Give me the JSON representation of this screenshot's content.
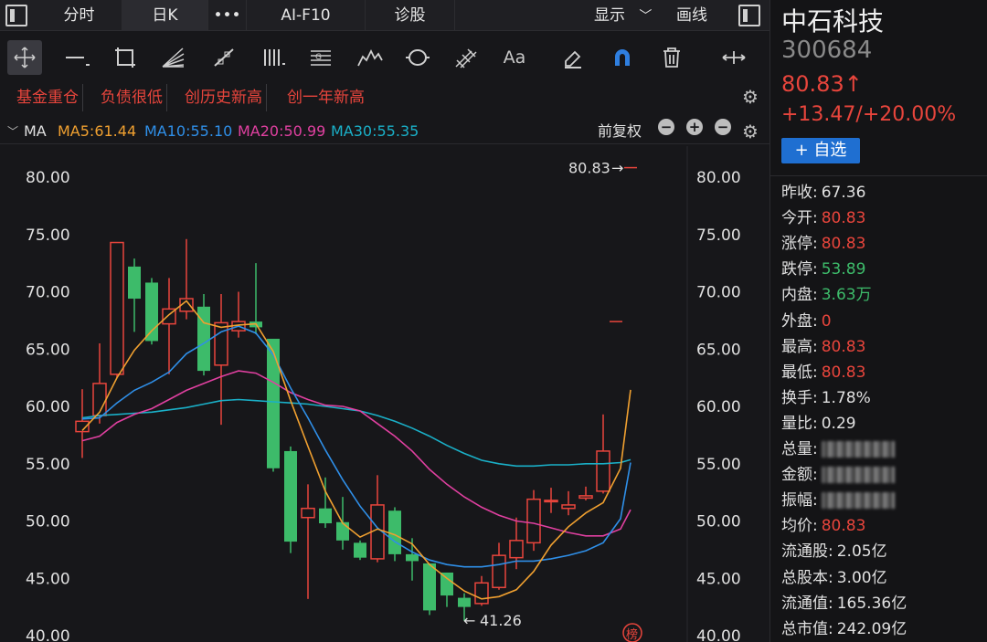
{
  "tabs": [
    "分时",
    "日K",
    "•••",
    "AI-F10",
    "诊股"
  ],
  "active_tab": 1,
  "top_right": {
    "display_label": "显示",
    "draw_label": "画线"
  },
  "tools": [
    "crosshair-icon",
    "line-icon",
    "rect-icon",
    "fan-icon",
    "ray-icon",
    "vlines-icon",
    "channel-icon",
    "wave-icon",
    "cycle-icon",
    "pitchfork-icon",
    "text-icon",
    "eraser-icon",
    "magnet-icon",
    "trash-icon",
    "arrows-icon"
  ],
  "tool_text_label": "Aa",
  "tags": [
    "基金重仓",
    "负债很低",
    "创历史新高",
    "创一年新高"
  ],
  "ma": {
    "label": "MA",
    "ma5": "MA5:61.44",
    "ma10": "MA10:55.10",
    "ma20": "MA20:50.99",
    "ma30": "MA30:55.35",
    "adjust": "前复权",
    "colors": {
      "ma5": "#f0a030",
      "ma10": "#2f8fe8",
      "ma20": "#e040a0",
      "ma30": "#1ab0c8"
    }
  },
  "chart_data": {
    "type": "candlestick",
    "ylim": [
      40,
      81.5
    ],
    "yticks": [
      40,
      45,
      50,
      55,
      60,
      65,
      70,
      75,
      80
    ],
    "ytick_labels": [
      "40.00",
      "45.00",
      "50.00",
      "55.00",
      "60.00",
      "65.00",
      "70.00",
      "75.00",
      "80.00"
    ],
    "candles": [
      {
        "o": 57.8,
        "c": 58.7,
        "h": 61.5,
        "l": 55.5
      },
      {
        "o": 59.2,
        "c": 62.0,
        "h": 65.5,
        "l": 58.5
      },
      {
        "o": 62.8,
        "c": 74.3,
        "h": 74.3,
        "l": 62.5
      },
      {
        "o": 72.2,
        "c": 69.4,
        "h": 72.9,
        "l": 66.5
      },
      {
        "o": 70.8,
        "c": 65.7,
        "h": 71.2,
        "l": 65.4
      },
      {
        "o": 67.2,
        "c": 68.5,
        "h": 71.2,
        "l": 62.8
      },
      {
        "o": 68.3,
        "c": 69.4,
        "h": 74.6,
        "l": 67.6
      },
      {
        "o": 68.7,
        "c": 63.1,
        "h": 69.8,
        "l": 62.7
      },
      {
        "o": 63.6,
        "c": 67.3,
        "h": 69.8,
        "l": 58.4
      },
      {
        "o": 66.6,
        "c": 67.4,
        "h": 70.0,
        "l": 66.0
      },
      {
        "o": 67.4,
        "c": 66.9,
        "h": 72.5,
        "l": 66.3
      },
      {
        "o": 65.9,
        "c": 54.6,
        "h": 65.9,
        "l": 54.3
      },
      {
        "o": 56.1,
        "c": 48.2,
        "h": 56.5,
        "l": 47.2
      },
      {
        "o": 50.3,
        "c": 51.1,
        "h": 53.2,
        "l": 43.2
      },
      {
        "o": 51.1,
        "c": 49.8,
        "h": 53.8,
        "l": 49.4
      },
      {
        "o": 49.9,
        "c": 48.3,
        "h": 52.1,
        "l": 47.5
      },
      {
        "o": 48.1,
        "c": 46.8,
        "h": 48.3,
        "l": 46.6
      },
      {
        "o": 46.7,
        "c": 51.4,
        "h": 54.0,
        "l": 46.4
      },
      {
        "o": 50.9,
        "c": 47.1,
        "h": 51.2,
        "l": 46.5
      },
      {
        "o": 47.1,
        "c": 46.5,
        "h": 48.5,
        "l": 44.8
      },
      {
        "o": 46.3,
        "c": 42.2,
        "h": 46.3,
        "l": 41.8
      },
      {
        "o": 45.5,
        "c": 43.5,
        "h": 45.5,
        "l": 42.5
      },
      {
        "o": 43.3,
        "c": 42.5,
        "h": 43.7,
        "l": 41.3
      },
      {
        "o": 42.8,
        "c": 44.6,
        "h": 45.2,
        "l": 42.6
      },
      {
        "o": 44.2,
        "c": 47.0,
        "h": 48.1,
        "l": 44.0
      },
      {
        "o": 46.8,
        "c": 48.3,
        "h": 50.3,
        "l": 45.8
      },
      {
        "o": 48.1,
        "c": 51.9,
        "h": 52.7,
        "l": 47.4
      },
      {
        "o": 51.8,
        "c": 51.8,
        "h": 52.9,
        "l": 50.7
      },
      {
        "o": 51.1,
        "c": 51.4,
        "h": 52.6,
        "l": 50.5
      },
      {
        "o": 52.0,
        "c": 52.2,
        "h": 53.0,
        "l": 51.8
      },
      {
        "o": 52.6,
        "c": 56.1,
        "h": 59.3,
        "l": 52.4
      },
      {
        "o": 67.4,
        "c": 67.4,
        "h": 67.4,
        "l": 67.4
      },
      {
        "o": 80.83,
        "c": 80.83,
        "h": 80.83,
        "l": 80.83
      }
    ],
    "ma_lines": {
      "ma5": [
        57.9,
        59.5,
        62.5,
        64.9,
        66.6,
        68.0,
        69.2,
        67.3,
        66.9,
        67.1,
        67.2,
        64.8,
        60.5,
        56.5,
        52.6,
        49.8,
        48.6,
        49.3,
        48.8,
        48.0,
        46.2,
        45.0,
        43.9,
        43.2,
        43.4,
        44.0,
        45.6,
        47.9,
        49.5,
        50.7,
        51.6,
        54.6,
        61.44
      ],
      "ma10": [
        58.9,
        59.0,
        60.3,
        61.4,
        62.1,
        63.0,
        64.6,
        65.5,
        66.5,
        67.0,
        66.4,
        64.5,
        61.6,
        59.0,
        56.2,
        53.6,
        51.3,
        49.4,
        48.2,
        47.3,
        46.6,
        46.2,
        46.0,
        46.0,
        46.2,
        46.5,
        46.5,
        46.7,
        47.0,
        47.4,
        48.1,
        50.2,
        55.1
      ],
      "ma20": [
        57.0,
        57.4,
        58.6,
        59.3,
        59.8,
        60.6,
        61.4,
        62.0,
        62.6,
        63.1,
        62.9,
        62.1,
        61.2,
        60.6,
        60.1,
        60.0,
        59.6,
        58.5,
        57.4,
        56.1,
        54.5,
        53.2,
        52.1,
        51.2,
        50.5,
        50.0,
        49.8,
        49.4,
        49.0,
        48.7,
        48.7,
        49.3,
        50.99
      ],
      "ma30": [
        59.0,
        59.2,
        59.3,
        59.4,
        59.5,
        59.7,
        59.9,
        60.2,
        60.5,
        60.6,
        60.5,
        60.4,
        60.3,
        60.2,
        60.0,
        59.8,
        59.6,
        59.2,
        58.7,
        58.1,
        57.4,
        56.6,
        55.9,
        55.3,
        55.0,
        54.8,
        54.8,
        54.9,
        54.9,
        55.0,
        55.0,
        55.1,
        55.35
      ]
    },
    "annotations": {
      "high_label": "80.83",
      "low_label": "41.26",
      "corner_badge": "榜"
    }
  },
  "stock": {
    "name": "中石科技",
    "code": "300684",
    "price": "80.83↑",
    "change": "+13.47/+20.00%",
    "add_button": "+ 自选"
  },
  "stats": [
    {
      "k": "昨收:",
      "v": "67.36",
      "color": "white"
    },
    {
      "k": "今开:",
      "v": "80.83",
      "color": "red"
    },
    {
      "k": "涨停:",
      "v": "80.83",
      "color": "red"
    },
    {
      "k": "跌停:",
      "v": "53.89",
      "color": "green"
    },
    {
      "k": "内盘:",
      "v": "3.63万",
      "color": "green"
    },
    {
      "k": "外盘:",
      "v": "0",
      "color": "red"
    },
    {
      "k": "最高:",
      "v": "80.83",
      "color": "red"
    },
    {
      "k": "最低:",
      "v": "80.83",
      "color": "red"
    },
    {
      "k": "换手:",
      "v": "1.78%",
      "color": "white"
    },
    {
      "k": "量比:",
      "v": "0.29",
      "color": "white"
    },
    {
      "k": "总量:",
      "v": "",
      "color": "blur"
    },
    {
      "k": "金额:",
      "v": "",
      "color": "blur"
    },
    {
      "k": "振幅:",
      "v": "",
      "color": "blur"
    },
    {
      "k": "均价:",
      "v": "80.83",
      "color": "red"
    },
    {
      "k": "流通股:",
      "v": "2.05亿",
      "color": "white"
    },
    {
      "k": "总股本:",
      "v": "3.00亿",
      "color": "white"
    },
    {
      "k": "流通值:",
      "v": "165.36亿",
      "color": "white"
    },
    {
      "k": "总市值:",
      "v": "242.09亿",
      "color": "white"
    }
  ]
}
